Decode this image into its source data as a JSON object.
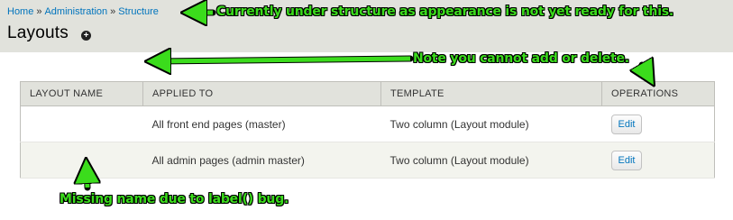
{
  "breadcrumb": {
    "items": [
      "Home",
      "Administration",
      "Structure"
    ],
    "separator": "»"
  },
  "page": {
    "title": "Layouts",
    "add_shortcut_symbol": "+"
  },
  "table": {
    "headers": [
      "LAYOUT NAME",
      "APPLIED TO",
      "TEMPLATE",
      "OPERATIONS"
    ],
    "rows": [
      {
        "name": "",
        "applied_to": "All front end pages (master)",
        "template": "Two column (Layout module)",
        "operation": "Edit"
      },
      {
        "name": "",
        "applied_to": "All admin pages (admin master)",
        "template": "Two column (Layout module)",
        "operation": "Edit"
      }
    ]
  },
  "annotations": {
    "note_structure": "Currently under structure as appearance is not yet ready for this.",
    "note_add_delete": "Note you cannot add or delete.",
    "note_missing_name": "Missing name due to label() bug."
  },
  "colors": {
    "header_bg": "#e1e2dc",
    "link": "#0074bd",
    "annotation_green": "#3bdc1c",
    "even_row_bg": "#f3f4ee"
  }
}
